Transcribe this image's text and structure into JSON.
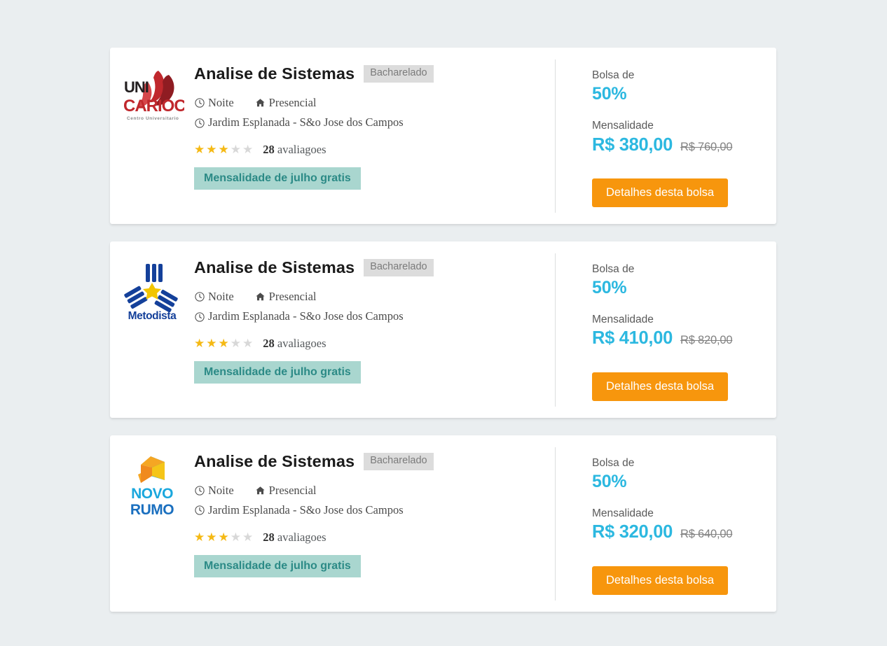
{
  "page": {
    "background_color": "#eaeef0",
    "accent_blue": "#2cb8e0",
    "accent_orange": "#f7960d",
    "promo_bg": "#a9d6cf",
    "promo_text_color": "#2b8a86"
  },
  "cards": [
    {
      "logo_name": "unicarioca-logo",
      "logo_alt": "UniCarioca Centro Universitario",
      "title": "Analise de Sistemas",
      "degree": "Bacharelado",
      "shift": "Noite",
      "modality": "Presencial",
      "location": "Jardim Esplanada - S&o Jose dos Campos",
      "rating_filled": 3,
      "rating_total": 5,
      "reviews_count": "28",
      "reviews_label": "avaliagoes",
      "promo": "Mensalidade de julho gratis",
      "scholarship_label": "Bolsa de",
      "scholarship_value": "50%",
      "tuition_label": "Mensalidade",
      "price_new": "R$ 380,00",
      "price_old": "R$ 760,00",
      "cta": "Detalhes desta bolsa"
    },
    {
      "logo_name": "metodista-logo",
      "logo_alt": "Metodista",
      "title": "Analise de Sistemas",
      "degree": "Bacharelado",
      "shift": "Noite",
      "modality": "Presencial",
      "location": "Jardim Esplanada - S&o Jose dos Campos",
      "rating_filled": 3,
      "rating_total": 5,
      "reviews_count": "28",
      "reviews_label": "avaliagoes",
      "promo": "Mensalidade de julho gratis",
      "scholarship_label": "Bolsa de",
      "scholarship_value": "50%",
      "tuition_label": "Mensalidade",
      "price_new": "R$ 410,00",
      "price_old": "R$ 820,00",
      "cta": "Detalhes desta bolsa"
    },
    {
      "logo_name": "novorumo-logo",
      "logo_alt": "Novo Rumo",
      "title": "Analise de Sistemas",
      "degree": "Bacharelado",
      "shift": "Noite",
      "modality": "Presencial",
      "location": "Jardim Esplanada - S&o Jose dos Campos",
      "rating_filled": 3,
      "rating_total": 5,
      "reviews_count": "28",
      "reviews_label": "avaliagoes",
      "promo": "Mensalidade de julho gratis",
      "scholarship_label": "Bolsa de",
      "scholarship_value": "50%",
      "tuition_label": "Mensalidade",
      "price_new": "R$ 320,00",
      "price_old": "R$ 640,00",
      "cta": "Detalhes desta bolsa"
    }
  ],
  "icons": {
    "shift": "clock-icon",
    "modality": "home-icon",
    "location": "clock-icon",
    "star_filled": "★",
    "star_empty": "★"
  }
}
